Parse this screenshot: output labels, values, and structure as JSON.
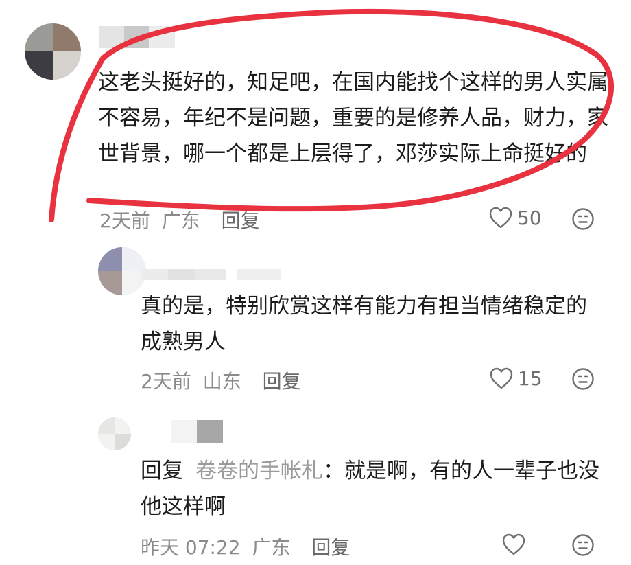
{
  "comments": [
    {
      "text": "这老头挺好的，知足吧，在国内能找个这样的男人实属不容易，年纪不是问题，重要的是修养人品，财力，家世背景，哪一个都是上层得了，邓莎实际上命挺好的",
      "time": "2天前",
      "location": "广东",
      "reply_label": "回复",
      "likes": "50"
    },
    {
      "text": "真的是，特别欣赏这样有能力有担当情绪稳定的成熟男人",
      "time": "2天前",
      "location": "山东",
      "reply_label": "回复",
      "likes": "15"
    },
    {
      "reply_prefix": "回复",
      "mention": "卷卷的手帐札",
      "colon": "：",
      "text": "就是啊，有的人一辈子也没他这样啊",
      "time": "昨天 07:22",
      "location": "广东",
      "reply_label": "回复",
      "likes": ""
    }
  ],
  "colors": {
    "annotation_red": "#e8323f",
    "meta_gray": "#8a8a8a",
    "icon_gray": "#6f6f6f"
  },
  "icons": [
    "heart-icon",
    "neutral-face-icon"
  ]
}
